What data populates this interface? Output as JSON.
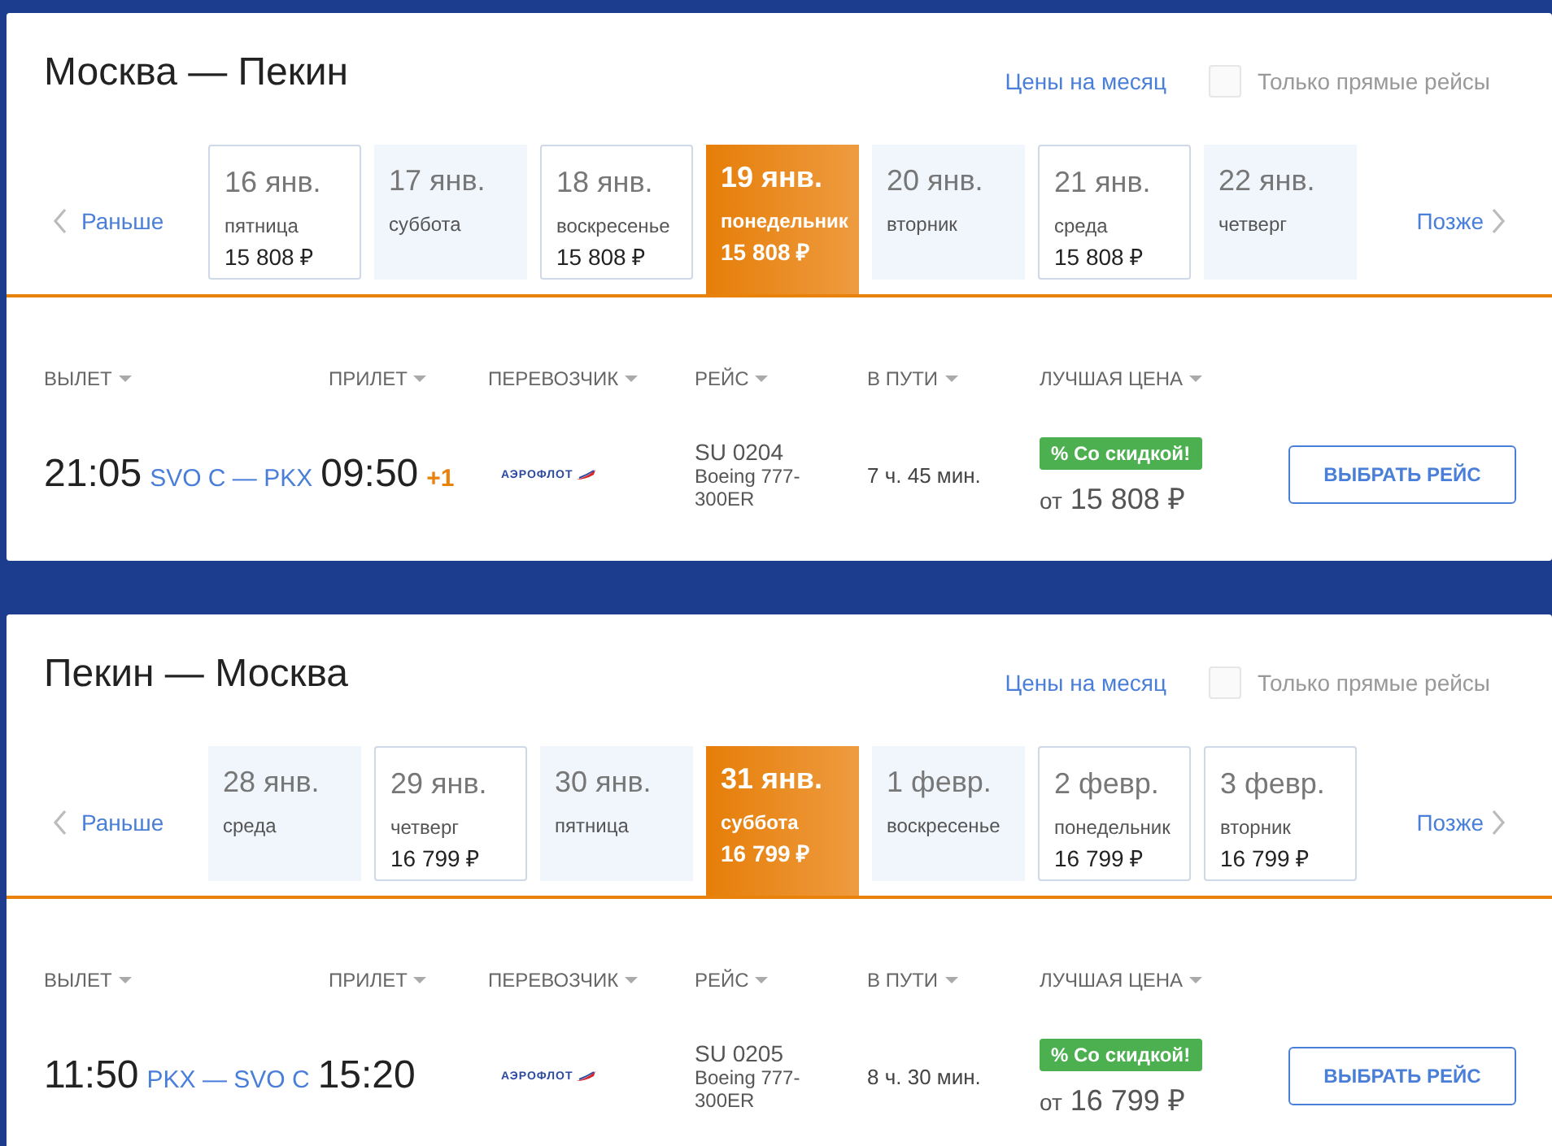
{
  "searches": [
    {
      "title": "Москва — Пекин",
      "month_link": "Цены на месяц",
      "direct_only": {
        "label": "Только прямые рейсы",
        "checked": false
      },
      "earlier": "Раньше",
      "later": "Позже",
      "days": [
        {
          "date": "16 янв.",
          "weekday": "пятница",
          "price": "15 808 ₽",
          "selected": false
        },
        {
          "date": "17 янв.",
          "weekday": "суббота",
          "selected": false
        },
        {
          "date": "18 янв.",
          "weekday": "воскресенье",
          "price": "15 808 ₽",
          "selected": false
        },
        {
          "date": "19 янв.",
          "weekday": "понедельник",
          "price": "15 808 ₽",
          "selected": true
        },
        {
          "date": "20 янв.",
          "weekday": "вторник",
          "selected": false
        },
        {
          "date": "21 янв.",
          "weekday": "среда",
          "price": "15 808 ₽",
          "selected": false
        },
        {
          "date": "22 янв.",
          "weekday": "четверг",
          "selected": false
        }
      ],
      "columns": [
        "ВЫЛЕТ",
        "ПРИЛЕТ",
        "ПЕРЕВОЗЧИК",
        "РЕЙС",
        "В ПУТИ",
        "ЛУЧШАЯ ЦЕНА"
      ],
      "flights": [
        {
          "departure": "21:05",
          "route": "SVO C — PKX",
          "arrival": "09:50",
          "next_day": "+1",
          "airline": "АЭРОФЛОТ",
          "flight_number": "SU 0204",
          "aircraft": "Boeing 777-300ER",
          "duration": "7 ч. 45 мин.",
          "badge": "% Со скидкой!",
          "price_prefix": "от",
          "price": "15 808 ₽",
          "button": "ВЫБРАТЬ РЕЙС"
        }
      ]
    },
    {
      "title": "Пекин — Москва",
      "month_link": "Цены на месяц",
      "direct_only": {
        "label": "Только прямые рейсы",
        "checked": false
      },
      "earlier": "Раньше",
      "later": "Позже",
      "days": [
        {
          "date": "28 янв.",
          "weekday": "среда",
          "selected": false
        },
        {
          "date": "29 янв.",
          "weekday": "четверг",
          "price": "16 799 ₽",
          "selected": false
        },
        {
          "date": "30 янв.",
          "weekday": "пятница",
          "selected": false
        },
        {
          "date": "31 янв.",
          "weekday": "суббота",
          "price": "16 799 ₽",
          "selected": true
        },
        {
          "date": "1 февр.",
          "weekday": "воскресенье",
          "selected": false
        },
        {
          "date": "2 февр.",
          "weekday": "понедельник",
          "price": "16 799 ₽",
          "selected": false
        },
        {
          "date": "3 февр.",
          "weekday": "вторник",
          "price": "16 799 ₽",
          "selected": false
        }
      ],
      "columns": [
        "ВЫЛЕТ",
        "ПРИЛЕТ",
        "ПЕРЕВОЗЧИК",
        "РЕЙС",
        "В ПУТИ",
        "ЛУЧШАЯ ЦЕНА"
      ],
      "flights": [
        {
          "departure": "11:50",
          "route": "PKX — SVO C",
          "arrival": "15:20",
          "airline": "АЭРОФЛОТ",
          "flight_number": "SU 0205",
          "aircraft": "Boeing 777-300ER",
          "duration": "8 ч. 30 мин.",
          "badge": "% Со скидкой!",
          "price_prefix": "от",
          "price": "16 799 ₽",
          "button": "ВЫБРАТЬ РЕЙС"
        }
      ]
    }
  ]
}
